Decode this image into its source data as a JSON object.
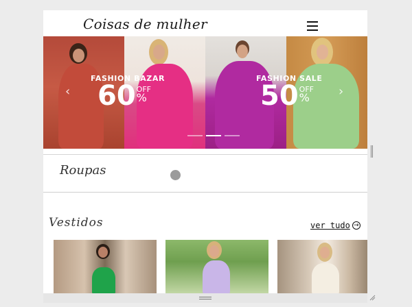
{
  "header": {
    "logo": "Coisas de mulher",
    "menu_icon": "hamburger-menu-icon"
  },
  "hero": {
    "promos": [
      {
        "kicker": "FASHION BAZAR",
        "value": "60",
        "off": "OFF",
        "percent": "%"
      },
      {
        "kicker": "FASHION SALE",
        "value": "50",
        "off": "OFF",
        "percent": "%"
      }
    ],
    "prev_icon": "chevron-left-icon",
    "next_icon": "chevron-right-icon",
    "prev_glyph": "‹",
    "next_glyph": "›",
    "slide_count": 3,
    "active_slide": 2
  },
  "roupas": {
    "title": "Roupas"
  },
  "vestidos": {
    "title": "Vestidos",
    "ver_tudo": "ver tudo",
    "ver_tudo_icon": "arrow-right-circle-icon",
    "arrow_glyph": "→"
  },
  "colors": {
    "panel_red": "#b44a3a",
    "panel_pink": "#e0307d",
    "panel_magenta": "#b02aa0",
    "panel_gold": "#c58a44",
    "dress_green": "#1fa34a",
    "dress_lilac": "#c9b6e8",
    "dress_cream": "#f4eee2"
  }
}
